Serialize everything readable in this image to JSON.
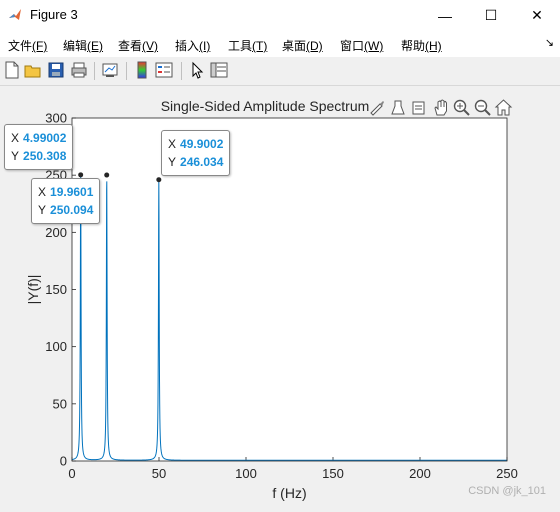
{
  "window": {
    "title": "Figure 3",
    "minimize_glyph": "—",
    "maximize_glyph": "☐",
    "close_glyph": "✕"
  },
  "menu": [
    {
      "label": "文件",
      "key": "(F)"
    },
    {
      "label": "编辑",
      "key": "(E)"
    },
    {
      "label": "查看",
      "key": "(V)"
    },
    {
      "label": "插入",
      "key": "(I)"
    },
    {
      "label": "工具",
      "key": "(T)"
    },
    {
      "label": "桌面",
      "key": "(D)"
    },
    {
      "label": "窗口",
      "key": "(W)"
    },
    {
      "label": "帮助",
      "key": "(H)"
    }
  ],
  "menu_dock_glyph": "↘",
  "toolbar_icons": [
    "new-figure-icon",
    "open-file-icon",
    "save-icon",
    "print-icon",
    "link-plot-icon",
    "insert-colorbar-icon",
    "insert-legend-icon",
    "edit-plot-icon",
    "property-inspector-icon"
  ],
  "axes_toolbar_icons": [
    "brush-icon",
    "data-tips-icon",
    "rotate-icon",
    "pan-icon",
    "zoom-in-icon",
    "zoom-out-icon",
    "home-icon"
  ],
  "chart_data": {
    "type": "line",
    "title": "Single-Sided Amplitude Spectrum",
    "xlabel": "f (Hz)",
    "ylabel": "|Y(f)|",
    "xlim": [
      0,
      250
    ],
    "ylim": [
      0,
      300
    ],
    "xticks": [
      0,
      50,
      100,
      150,
      200,
      250
    ],
    "yticks": [
      0,
      50,
      100,
      150,
      200,
      250,
      300
    ],
    "grid": false,
    "color": "#0072bd",
    "peaks": [
      {
        "x": 4.99002,
        "y": 250.308
      },
      {
        "x": 19.9601,
        "y": 250.094
      },
      {
        "x": 49.9002,
        "y": 246.034
      }
    ],
    "datatips": [
      {
        "x_label": "X",
        "x_value": "4.99002",
        "y_label": "Y",
        "y_value": "250.308"
      },
      {
        "x_label": "X",
        "x_value": "19.9601",
        "y_label": "Y",
        "y_value": "250.094"
      },
      {
        "x_label": "X",
        "x_value": "49.9002",
        "y_label": "Y",
        "y_value": "246.034"
      }
    ]
  },
  "watermark": "CSDN @jk_101"
}
